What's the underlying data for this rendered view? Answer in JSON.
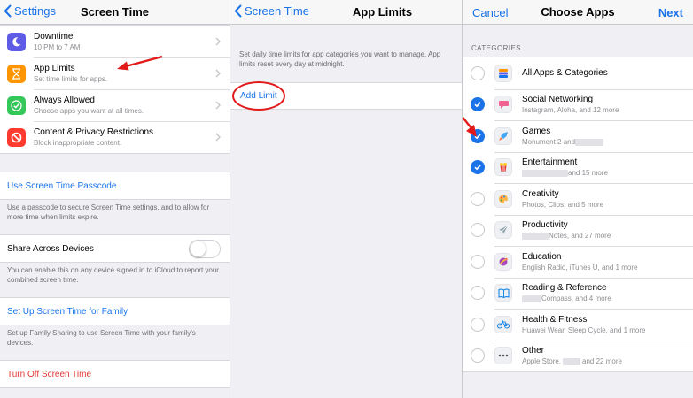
{
  "screen_time": {
    "back_label": "Settings",
    "title": "Screen Time",
    "rows": [
      {
        "title": "Downtime",
        "subtitle": "10 PM to 7 AM",
        "icon": "moon-icon",
        "color": "#5e5ce6"
      },
      {
        "title": "App Limits",
        "subtitle": "Set time limits for apps.",
        "icon": "hourglass-icon",
        "color": "#ff9500"
      },
      {
        "title": "Always Allowed",
        "subtitle": "Choose apps you want at all times.",
        "icon": "checkmark-icon",
        "color": "#34c759"
      },
      {
        "title": "Content & Privacy Restrictions",
        "subtitle": "Block inappropriate content.",
        "icon": "no-entry-icon",
        "color": "#ff3b30"
      }
    ],
    "passcode_label": "Use Screen Time Passcode",
    "passcode_footer": "Use a passcode to secure Screen Time settings, and to allow for more time when limits expire.",
    "share_label": "Share Across Devices",
    "share_footer": "You can enable this on any device signed in to iCloud to report your combined screen time.",
    "family_label": "Set Up Screen Time for Family",
    "family_footer": "Set up Family Sharing to use Screen Time with your family's devices.",
    "turn_off_label": "Turn Off Screen Time"
  },
  "app_limits": {
    "back_label": "Screen Time",
    "title": "App Limits",
    "description": "Set daily time limits for app categories you want to manage. App limits reset every day at midnight.",
    "add_limit_label": "Add Limit"
  },
  "choose_apps": {
    "cancel_label": "Cancel",
    "title": "Choose Apps",
    "next_label": "Next",
    "section_header": "CATEGORIES",
    "categories": [
      {
        "title": "All Apps & Categories",
        "subtitle": "",
        "checked": false,
        "icon": "stack-icon"
      },
      {
        "title": "Social Networking",
        "subtitle": "Instagram, Aloha, and 12 more",
        "checked": true,
        "icon": "speech-bubble-icon"
      },
      {
        "title": "Games",
        "subtitle_before": "Monument 2 and",
        "subtitle_after": "",
        "checked": true,
        "icon": "rocket-icon"
      },
      {
        "title": "Entertainment",
        "subtitle_before": "",
        "subtitle_after": "and 15 more",
        "checked": true,
        "icon": "popcorn-icon"
      },
      {
        "title": "Creativity",
        "subtitle": "Photos, Clips, and 5 more",
        "checked": false,
        "icon": "palette-icon"
      },
      {
        "title": "Productivity",
        "subtitle_before": "",
        "subtitle_after": "Notes, and 27 more",
        "checked": false,
        "icon": "paper-plane-icon"
      },
      {
        "title": "Education",
        "subtitle": "English Radio, iTunes U, and 1 more",
        "checked": false,
        "icon": "globe-icon"
      },
      {
        "title": "Reading & Reference",
        "subtitle_before": "",
        "subtitle_after": "Compass, and 4 more",
        "checked": false,
        "icon": "book-icon"
      },
      {
        "title": "Health & Fitness",
        "subtitle": "Huawei Wear, Sleep Cycle, and 1 more",
        "checked": false,
        "icon": "bicycle-icon"
      },
      {
        "title": "Other",
        "subtitle_before": "Apple Store,",
        "subtitle_after": "and 22 more",
        "checked": false,
        "icon": "ellipsis-icon"
      }
    ]
  },
  "colors": {
    "accent": "#1a73e8",
    "destructive": "#e53935",
    "annotation": "#e21a1a"
  }
}
